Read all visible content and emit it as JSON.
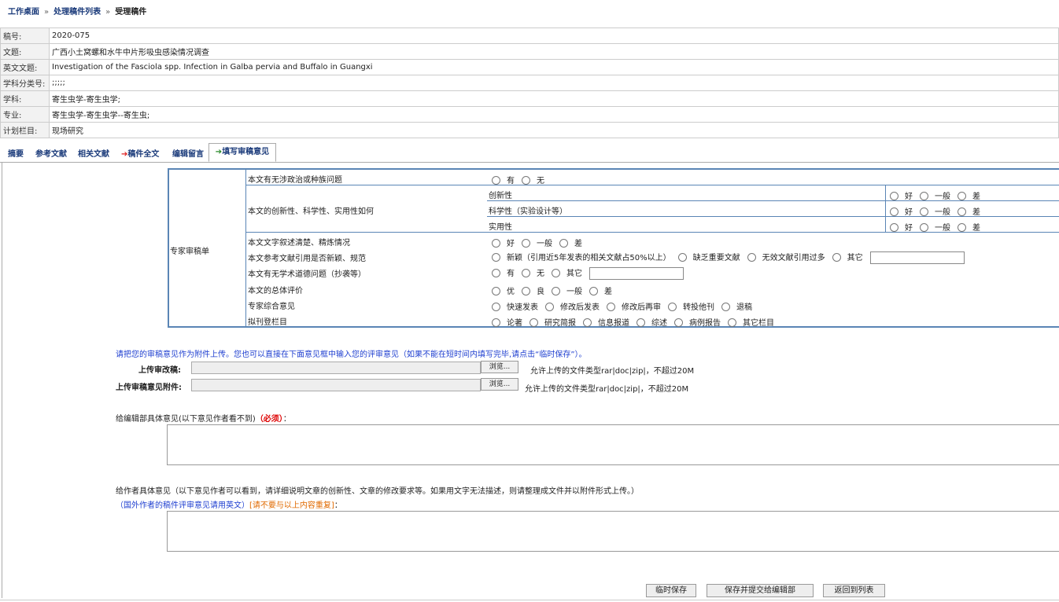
{
  "breadcrumb": {
    "home": "工作桌面",
    "list": "处理稿件列表",
    "current": "受理稿件",
    "sep": "»"
  },
  "info": [
    {
      "label": "稿号:",
      "value": "2020-075"
    },
    {
      "label": "文题:",
      "value": "广西小土窝螺和水牛中片形吸虫感染情况调查"
    },
    {
      "label": "英文文题:",
      "value": "Investigation of the Fasciola spp. Infection in Galba pervia and Buffalo in Guangxi"
    },
    {
      "label": "学科分类号:",
      "value": ";;;;;"
    },
    {
      "label": "学科:",
      "value": "寄生虫学-寄生虫学;"
    },
    {
      "label": "专业:",
      "value": "寄生虫学-寄生虫学--寄生虫;"
    },
    {
      "label": "计划栏目:",
      "value": "现场研究"
    }
  ],
  "tabs": {
    "abstract": "摘要",
    "references": "参考文献",
    "related": "相关文献",
    "fulltext_arrow": "➔",
    "fulltext": "稿件全文",
    "editor_msg": "编辑留言",
    "review_arrow": "➔",
    "review": "填写审稿意见"
  },
  "review": {
    "left_label": "专家审稿单",
    "q1": {
      "label": "本文有无涉政治或种族问题",
      "options": [
        "有",
        "无"
      ]
    },
    "q2": {
      "label": "本文的创新性、科学性、实用性如何",
      "sub": [
        {
          "label": "创新性",
          "options": [
            "好",
            "一般",
            "差"
          ]
        },
        {
          "label": "科学性（实验设计等）",
          "options": [
            "好",
            "一般",
            "差"
          ]
        },
        {
          "label": "实用性",
          "options": [
            "好",
            "一般",
            "差"
          ]
        }
      ]
    },
    "q3": {
      "label": "本文文字叙述清楚、精炼情况",
      "options": [
        "好",
        "一般",
        "差"
      ]
    },
    "q4": {
      "label": "本文参考文献引用是否新颖、规范",
      "options": [
        "新颖（引用近5年发表的相关文献占50%以上）",
        "缺乏重要文献",
        "无效文献引用过多",
        "其它"
      ]
    },
    "q5": {
      "label": "本文有无学术道德问题（抄袭等）",
      "options": [
        "有",
        "无",
        "其它"
      ]
    },
    "q6": {
      "label": "本文的总体评价",
      "options": [
        "优",
        "良",
        "一般",
        "差"
      ]
    },
    "q7": {
      "label": "专家综合意见",
      "options": [
        "快速发表",
        "修改后发表",
        "修改后再审",
        "转投他刊",
        "退稿"
      ]
    },
    "q8": {
      "label": "拟刊登栏目",
      "options": [
        "论著",
        "研究简报",
        "信息报道",
        "综述",
        "病例报告",
        "其它栏目"
      ]
    }
  },
  "upload": {
    "note": "请把您的审稿意见作为附件上传。您也可以直接在下面意见框中输入您的评审意见（如果不能在短时间内填写完毕,请点击“临时保存”）。",
    "revised_label": "上传审改稿:",
    "attach_label": "上传审稿意见附件:",
    "browse": "浏览...",
    "allow1": "允许上传的文件类型rar|doc|zip|，不超过20M",
    "allow2": "允许上传的文件类型rar|doc|zip|，不超过20M"
  },
  "editor_comment": {
    "label": "给编辑部具体意见(以下意见作者看不到)",
    "required": "（必须）",
    "colon": "："
  },
  "author_comment": {
    "label": "给作者具体意见（以下意见作者可以看到，请详细说明文章的创新性、文章的修改要求等。如果用文字无法描述，则请整理成文件并以附件形式上传。）",
    "note_blue": "（国外作者的稿件评审意见请用英文）",
    "note_orange": "[请不要与以上内容重复]",
    "colon": "："
  },
  "buttons": {
    "temp_save": "临时保存",
    "save_submit": "保存并提交给编辑部",
    "back": "返回到列表"
  }
}
